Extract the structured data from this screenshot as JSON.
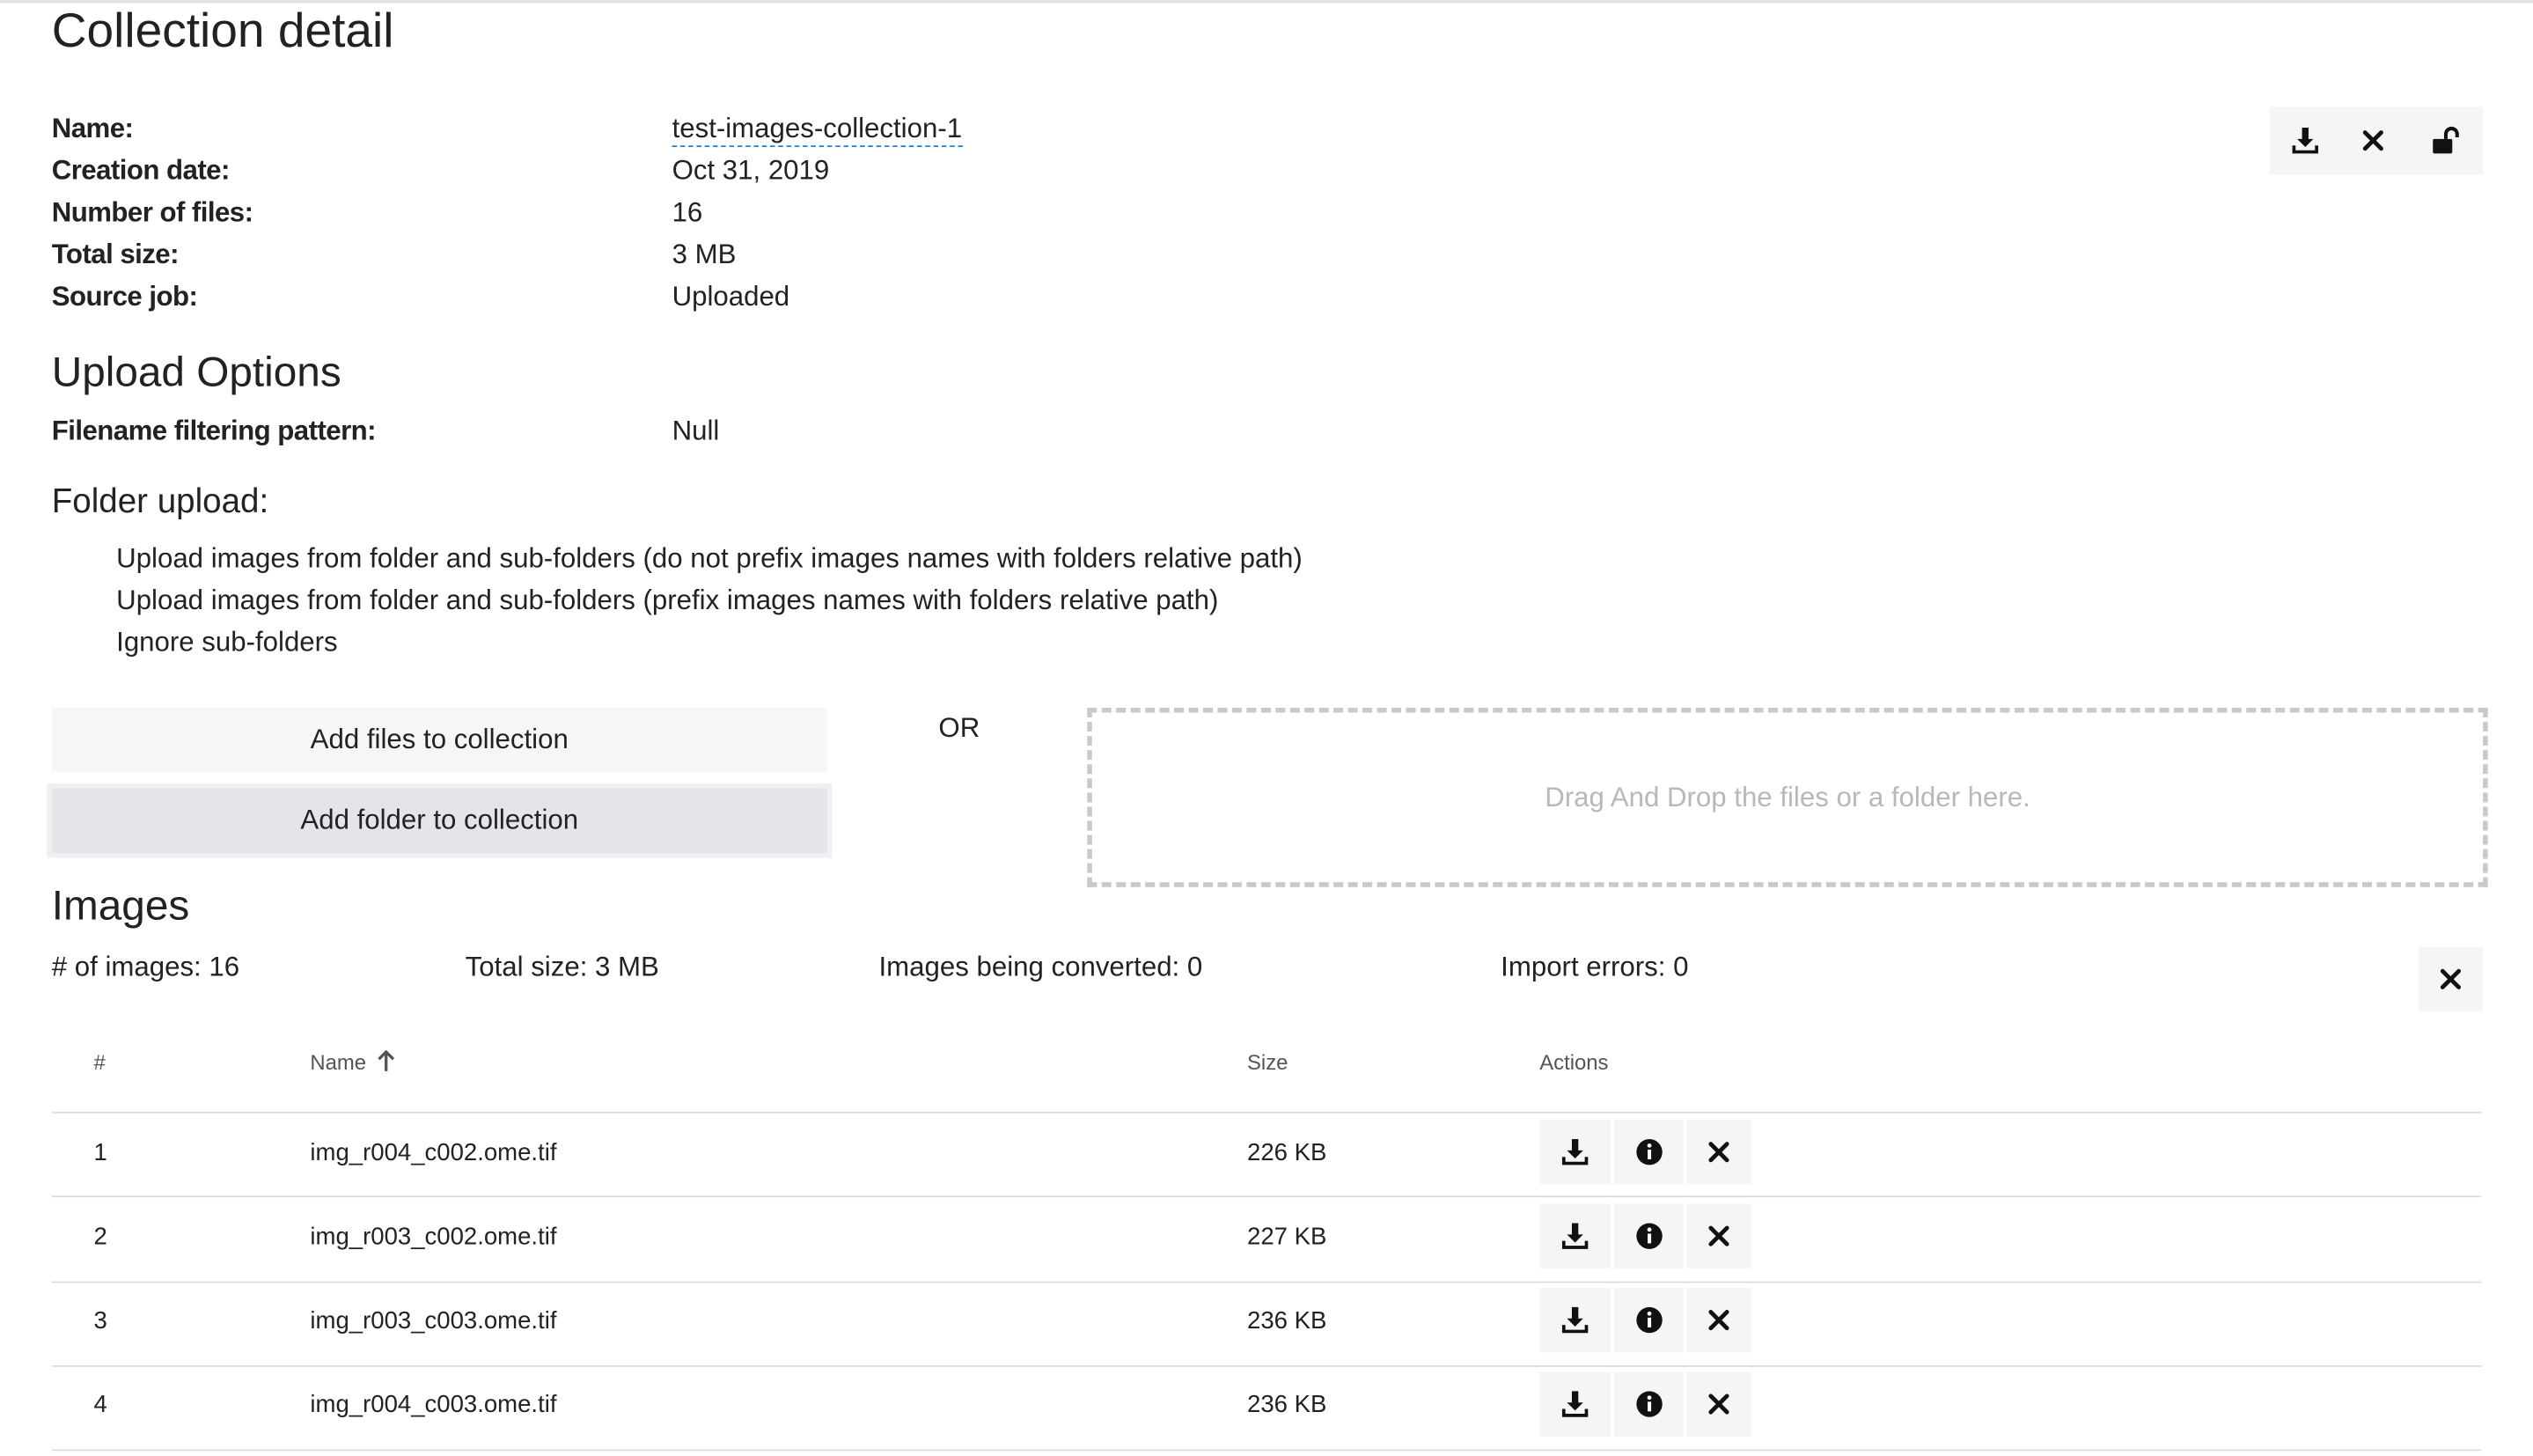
{
  "page_title": "Collection detail",
  "details": {
    "name_label": "Name:",
    "name_value": "test-images-collection-1",
    "date_label": "Creation date:",
    "date_value": "Oct 31, 2019",
    "files_label": "Number of files:",
    "files_value": "16",
    "size_label": "Total size:",
    "size_value": "3 MB",
    "source_label": "Source job:",
    "source_value": "Uploaded"
  },
  "header_actions": {
    "icons": [
      "download-icon",
      "close-icon",
      "unlock-icon"
    ]
  },
  "upload_options": {
    "title": "Upload Options",
    "filter_label": "Filename filtering pattern:",
    "filter_value": "Null",
    "folder_title": "Folder upload:",
    "folder_options": [
      "Upload images from folder and sub-folders (do not prefix images names with folders relative path)",
      "Upload images from folder and sub-folders (prefix images names with folders relative path)",
      "Ignore sub-folders"
    ]
  },
  "upload_actions": {
    "add_files": "Add files to collection",
    "add_folder": "Add folder to collection",
    "or": "OR",
    "dropzone": "Drag And Drop the files or a folder here."
  },
  "images": {
    "title": "Images",
    "count": "# of images: 16",
    "total_size": "Total size: 3 MB",
    "converting": "Images being converted: 0",
    "errors": "Import errors: 0",
    "columns": [
      "#",
      "Name",
      "Size",
      "Actions"
    ],
    "sort_icon": "arrow-up-icon",
    "rows": [
      {
        "index": "1",
        "name": "img_r004_c002.ome.tif",
        "size": "226 KB"
      },
      {
        "index": "2",
        "name": "img_r003_c002.ome.tif",
        "size": "227 KB"
      },
      {
        "index": "3",
        "name": "img_r003_c003.ome.tif",
        "size": "236 KB"
      },
      {
        "index": "4",
        "name": "img_r004_c003.ome.tif",
        "size": "236 KB"
      }
    ],
    "row_action_icons": [
      "download-icon",
      "info-icon",
      "close-icon"
    ]
  }
}
